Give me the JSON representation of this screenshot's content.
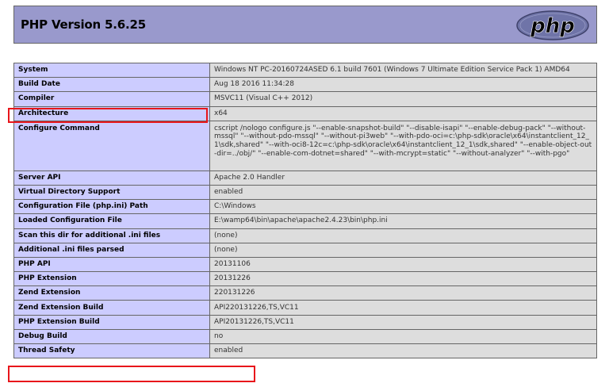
{
  "header": {
    "title": "PHP Version 5.6.25",
    "logo_text": "php"
  },
  "rows": [
    {
      "label": "System",
      "value": "Windows NT PC-20160724ASED 6.1 build 7601 (Windows 7 Ultimate Edition Service Pack 1) AMD64"
    },
    {
      "label": "Build Date",
      "value": "Aug 18 2016 11:34:28"
    },
    {
      "label": "Compiler",
      "value": "MSVC11 (Visual C++ 2012)"
    },
    {
      "label": "Architecture",
      "value": "x64"
    },
    {
      "label": "Configure Command",
      "value": "cscript /nologo configure.js \"--enable-snapshot-build\" \"--disable-isapi\" \"--enable-debug-pack\" \"--without-mssql\" \"--without-pdo-mssql\" \"--without-pi3web\" \"--with-pdo-oci=c:\\php-sdk\\oracle\\x64\\instantclient_12_1\\sdk,shared\" \"--with-oci8-12c=c:\\php-sdk\\oracle\\x64\\instantclient_12_1\\sdk,shared\" \"--enable-object-out-dir=../obj/\" \"--enable-com-dotnet=shared\" \"--with-mcrypt=static\" \"--without-analyzer\" \"--with-pgo\""
    },
    {
      "label": "Server API",
      "value": "Apache 2.0 Handler"
    },
    {
      "label": "Virtual Directory Support",
      "value": "enabled"
    },
    {
      "label": "Configuration File (php.ini) Path",
      "value": "C:\\Windows"
    },
    {
      "label": "Loaded Configuration File",
      "value": "E:\\wamp64\\bin\\apache\\apache2.4.23\\bin\\php.ini"
    },
    {
      "label": "Scan this dir for additional .ini files",
      "value": "(none)"
    },
    {
      "label": "Additional .ini files parsed",
      "value": "(none)"
    },
    {
      "label": "PHP API",
      "value": "20131106"
    },
    {
      "label": "PHP Extension",
      "value": "20131226"
    },
    {
      "label": "Zend Extension",
      "value": "220131226"
    },
    {
      "label": "Zend Extension Build",
      "value": "API220131226,TS,VC11"
    },
    {
      "label": "PHP Extension Build",
      "value": "API20131226,TS,VC11"
    },
    {
      "label": "Debug Build",
      "value": "no"
    },
    {
      "label": "Thread Safety",
      "value": "enabled"
    }
  ],
  "colors": {
    "header_bg": "#9999cc",
    "label_bg": "#ccccff",
    "value_bg": "#dddddd",
    "highlight": "#e8161b"
  }
}
